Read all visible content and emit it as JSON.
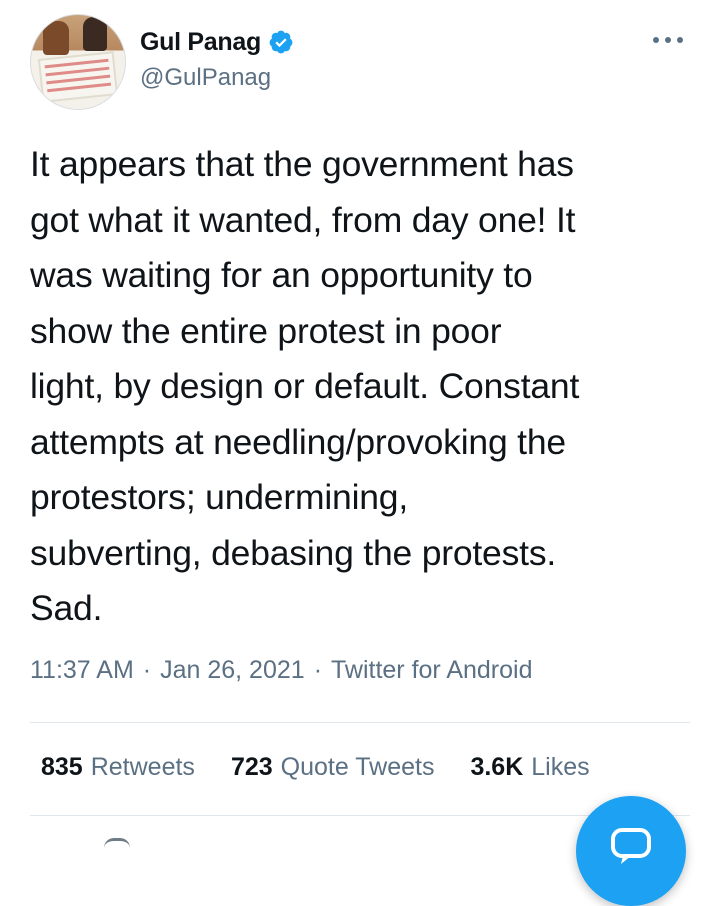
{
  "tweet": {
    "author": {
      "display_name": "Gul Panag",
      "handle": "@GulPanag",
      "verified": true
    },
    "text": "It appears that the government has\ngot what it wanted, from day one! It\nwas waiting for an opportunity to\nshow the entire protest in poor\nlight, by design or default. Constant\nattempts at needling/provoking the\nprotestors; undermining,\nsubverting, debasing the protests.\nSad.",
    "time": "11:37 AM",
    "date": "Jan 26, 2021",
    "separator": "·",
    "source": "Twitter for Android"
  },
  "stats": {
    "retweets": {
      "count": "835",
      "label": "Retweets"
    },
    "quote_tweets": {
      "count": "723",
      "label": "Quote Tweets"
    },
    "likes": {
      "count": "3.6K",
      "label": "Likes"
    }
  },
  "icons": {
    "verified": "verified-badge-icon",
    "more": "more-options-icon",
    "compose": "compose-tweet-icon"
  },
  "colors": {
    "accent": "#1da1f2",
    "text": "#0f1419",
    "secondary_text": "#5b7083",
    "divider": "#e1e8ed"
  }
}
